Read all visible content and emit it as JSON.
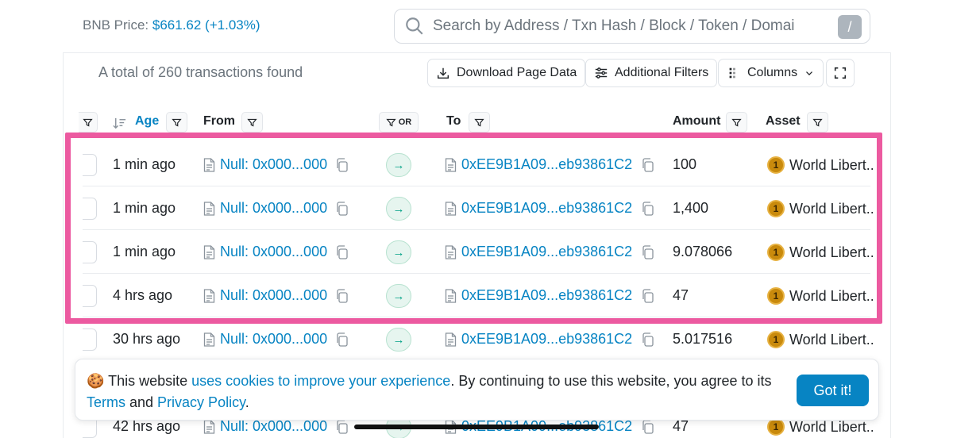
{
  "header": {
    "price_label": "BNB Price:",
    "price_value": "$661.62 (+1.03%)",
    "search_placeholder": "Search by Address / Txn Hash / Block / Token / Domai",
    "search_shortcut": "/"
  },
  "toolbar": {
    "total_text": "A total of 260 transactions found",
    "download_label": "Download Page Data",
    "filters_label": "Additional Filters",
    "columns_label": "Columns"
  },
  "table": {
    "headers": {
      "age": "Age",
      "from": "From",
      "or": "OR",
      "to": "To",
      "amount": "Amount",
      "asset": "Asset"
    },
    "rows": [
      {
        "age": "1 min ago",
        "from": "Null: 0x000...000",
        "to": "0xEE9B1A09...eb93861C2",
        "amount": "100",
        "asset": "World Libert..",
        "coin": "1"
      },
      {
        "age": "1 min ago",
        "from": "Null: 0x000...000",
        "to": "0xEE9B1A09...eb93861C2",
        "amount": "1,400",
        "asset": "World Libert..",
        "coin": "1"
      },
      {
        "age": "1 min ago",
        "from": "Null: 0x000...000",
        "to": "0xEE9B1A09...eb93861C2",
        "amount": "9.078066",
        "asset": "World Libert..",
        "coin": "1"
      },
      {
        "age": "4 hrs ago",
        "from": "Null: 0x000...000",
        "to": "0xEE9B1A09...eb93861C2",
        "amount": "47",
        "asset": "World Libert..",
        "coin": "1"
      },
      {
        "age": "30 hrs ago",
        "from": "Null: 0x000...000",
        "to": "0xEE9B1A09...eb93861C2",
        "amount": "5.017516",
        "asset": "World Libert..",
        "coin": "1"
      },
      {
        "age": "42 hrs ago",
        "from": "Null: 0x000...000",
        "to": "0xEE9B1A09...eb93861C2",
        "amount": "47",
        "asset": "World Libert..",
        "coin": "1"
      }
    ]
  },
  "cookie": {
    "prefix": "This website ",
    "link1": "uses cookies to improve your experience",
    "middle": ". By continuing to use this website, you agree to its ",
    "link2": "Terms",
    "and": " and ",
    "link3": "Privacy Policy",
    "suffix": ".",
    "button": "Got it!"
  },
  "colors": {
    "link": "#0784c3",
    "highlight": "#ec5aa0",
    "arrow_bg": "#e6f5ef",
    "coin": "#c98a0c"
  }
}
